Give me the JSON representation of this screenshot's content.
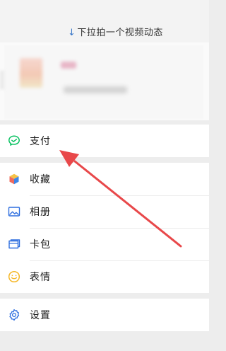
{
  "pull_hint": {
    "arrow": "↓",
    "text": "下拉拍一个视频动态"
  },
  "menu": {
    "pay": {
      "label": "支付",
      "icon": "wechat-pay-icon",
      "color": "#07c160"
    },
    "favorites": {
      "label": "收藏",
      "icon": "favorites-cube-icon"
    },
    "album": {
      "label": "相册",
      "icon": "album-picture-icon",
      "color": "#2f6fdf"
    },
    "cards": {
      "label": "卡包",
      "icon": "card-wallet-icon",
      "color": "#2f6fdf"
    },
    "stickers": {
      "label": "表情",
      "icon": "smiley-sticker-icon",
      "color": "#f5b728"
    },
    "settings": {
      "label": "设置",
      "icon": "gear-icon",
      "color": "#2f6fdf"
    }
  },
  "annotation": {
    "arrow_color": "#e8484a",
    "icon": "red-pointer-arrow-icon"
  }
}
